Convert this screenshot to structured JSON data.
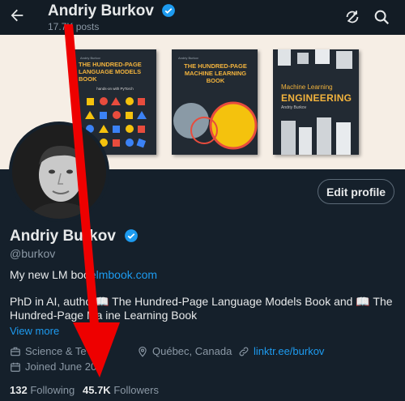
{
  "header": {
    "name": "Andriy Burkov",
    "posts": "17.7K posts"
  },
  "banner": {
    "books": [
      {
        "author": "Andriy Burkov",
        "title": "THE HUNDRED-PAGE LANGUAGE MODELS BOOK",
        "subtitle": "hands-on with PyTorch"
      },
      {
        "author": "Andriy Burkov",
        "title": "THE HUNDRED-PAGE MACHINE LEARNING BOOK"
      },
      {
        "title_line1": "Machine Learning",
        "title_line2": "ENGINEERING",
        "author": "Andriy Burkov"
      }
    ]
  },
  "profile": {
    "edit_label": "Edit profile",
    "name": "Andriy Burkov",
    "handle": "@burkov",
    "bio_line1_prefix": "My new LM boo",
    "bio_line1_link": "elmbook.com",
    "bio_line2": "PhD in AI, autho  📖 The Hundred-Page Language Models Book and 📖 The Hundred-Page Ma  ine Learning Book",
    "view_more": "View more",
    "category": "Science & Te      ogy",
    "location": "Québec, Canada",
    "website": "linktr.ee/burkov",
    "joined": "Joined June 20"
  },
  "stats": {
    "following_count": "132",
    "following_label": "Following",
    "followers_count": "45.7K",
    "followers_label": "Followers"
  },
  "colors": {
    "background": "#15202b",
    "accent": "#1d9bf0",
    "annotation_arrow": "#ee0000",
    "book_title": "#f2b33d"
  }
}
